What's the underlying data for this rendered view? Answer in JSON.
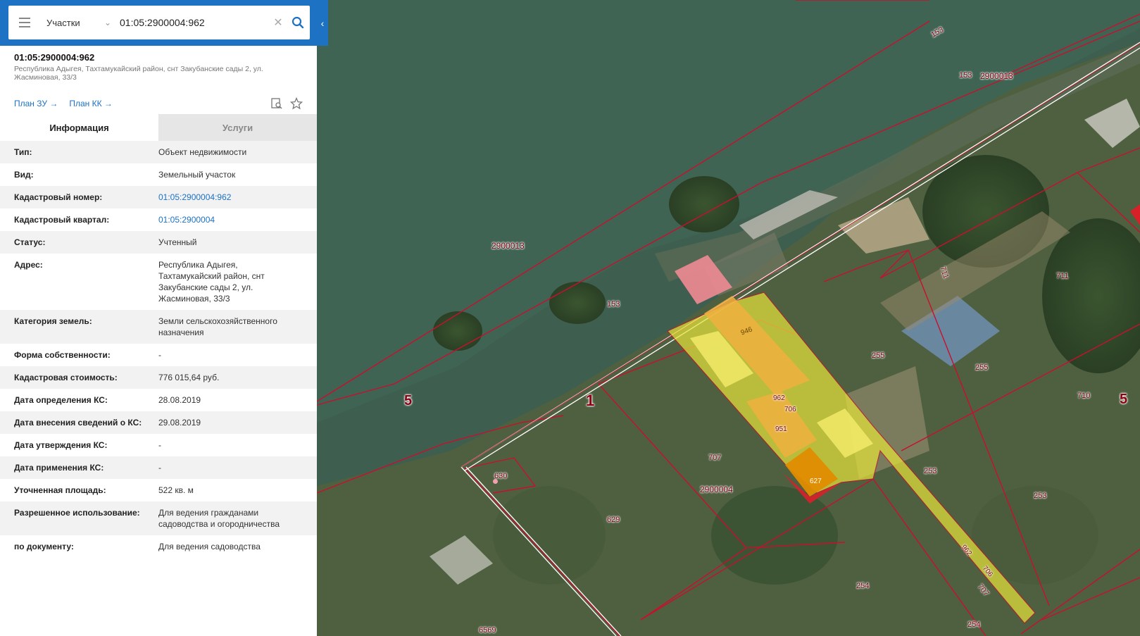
{
  "search": {
    "type_label": "Участки",
    "query": "01:05:2900004:962"
  },
  "object": {
    "title": "01:05:2900004:962",
    "address": "Республика Адыгея, Тахтамукайский район, снт Закубанские сады 2, ул. Жасминовая, 33/3",
    "plan_zu": "План ЗУ →",
    "plan_kk": "План КК →"
  },
  "tabs": {
    "info": "Информация",
    "services": "Услуги"
  },
  "rows": [
    {
      "k": "Тип:",
      "v": "Объект недвижимости"
    },
    {
      "k": "Вид:",
      "v": "Земельный участок"
    },
    {
      "k": "Кадастровый номер:",
      "v": "01:05:2900004:962"
    },
    {
      "k": "Кадастровый квартал:",
      "v": "01:05:2900004"
    },
    {
      "k": "Статус:",
      "v": "Учтенный"
    },
    {
      "k": "Адрес:",
      "v": "Республика Адыгея, Тахтамукайский район, снт Закубанские сады 2, ул. Жасминовая, 33/3"
    },
    {
      "k": "Категория земель:",
      "v": "Земли сельскохозяйственного назначения"
    },
    {
      "k": "Форма собственности:",
      "v": "-"
    },
    {
      "k": "Кадастровая стоимость:",
      "v": "776 015,64 руб."
    },
    {
      "k": "Дата определения КС:",
      "v": "28.08.2019"
    },
    {
      "k": "Дата внесения сведений о КС:",
      "v": "29.08.2019"
    },
    {
      "k": "Дата утверждения КС:",
      "v": "-"
    },
    {
      "k": "Дата применения КС:",
      "v": "-"
    },
    {
      "k": "Уточненная площадь:",
      "v": "522 кв. м"
    },
    {
      "k": "Разрешенное использование:",
      "v": "Для ведения гражданами садоводства и огородничества"
    },
    {
      "k": "по документу:",
      "v": "Для ведения садоводства"
    }
  ],
  "map_labels": {
    "l153a": "153",
    "l153b": "153",
    "l2900013a": "2900013",
    "l2900013b": "2900013",
    "l153c": "153",
    "l5a": "5",
    "l1": "1",
    "l711a": "711",
    "l711b": "711",
    "l255a": "255",
    "l255b": "255",
    "l710": "710",
    "l5b": "5",
    "l946": "946",
    "l962a": "962",
    "l706a": "706",
    "l951": "951",
    "l627": "627",
    "l707a": "707",
    "l2900004": "2900004",
    "l630": "630",
    "l629": "629",
    "l253a": "253",
    "l253b": "253",
    "l962b": "962",
    "l706b": "706",
    "l707b": "707",
    "l254a": "254",
    "l254b": "254",
    "l6569": "6569"
  },
  "colors": {
    "brand_blue": "#1d72c3",
    "parcel_line": "#c8102e",
    "highlight_yellow": "#e8e53a",
    "highlight_orange": "#f0b040"
  }
}
